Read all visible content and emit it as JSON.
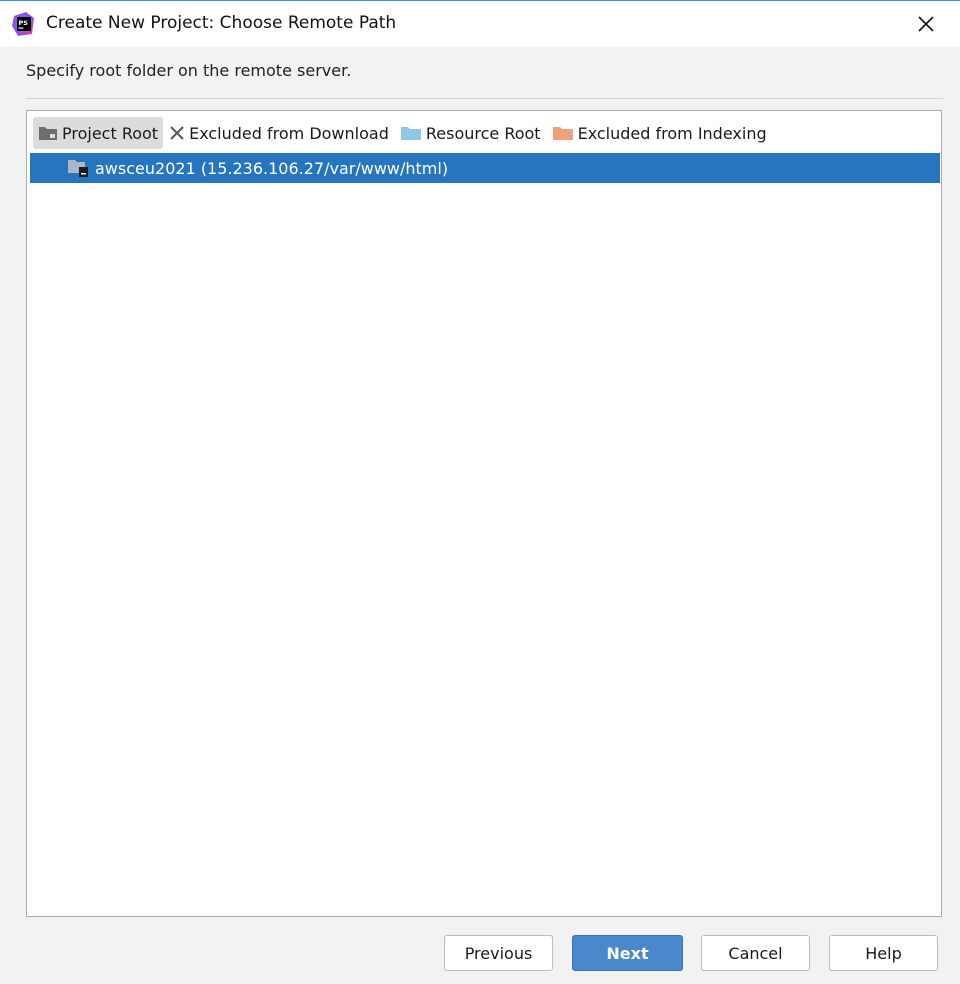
{
  "window": {
    "title": "Create New Project: Choose Remote Path",
    "app_icon_text": "PS"
  },
  "subtitle": "Specify root folder on the remote server.",
  "toolbar": {
    "items": [
      {
        "label": "Project Root",
        "icon": "project-root-folder-icon",
        "active": true
      },
      {
        "label": "Excluded from Download",
        "icon": "x-icon",
        "active": false
      },
      {
        "label": "Resource Root",
        "icon": "resource-folder-icon",
        "color": "#8dc9e4",
        "active": false
      },
      {
        "label": "Excluded from Indexing",
        "icon": "excluded-folder-icon",
        "color": "#f0a07a",
        "active": false
      }
    ]
  },
  "tree": {
    "items": [
      {
        "label": "awsceu2021 (15.236.106.27/var/www/html)",
        "icon": "remote-folder-icon",
        "selected": true
      }
    ]
  },
  "buttons": {
    "previous": "Previous",
    "next": "Next",
    "cancel": "Cancel",
    "help": "Help"
  },
  "colors": {
    "selection": "#2675bf",
    "primary_button": "#4a88cc",
    "app_icon": "#8a2be2"
  }
}
